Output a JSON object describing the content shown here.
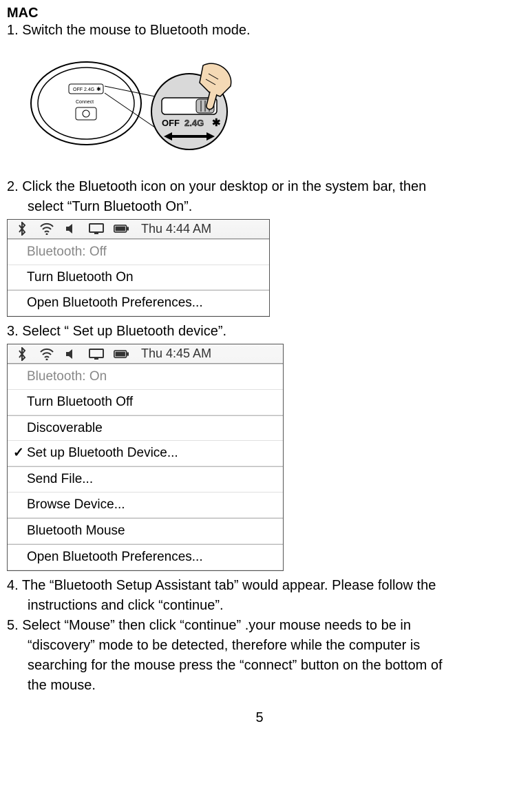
{
  "title": "MAC",
  "steps": {
    "s1": "1. Switch the mouse to Bluetooth mode.",
    "s2a": "2. Click the Bluetooth icon on your desktop or in the system bar, then",
    "s2b": "select “Turn Bluetooth On”.",
    "s3": "3. Select “ Set up Bluetooth device”.",
    "s4a": "4. The “Bluetooth Setup Assistant tab” would appear. Please follow the",
    "s4b": "instructions and click “continue”.",
    "s5a": "5. Select “Mouse” then click “continue” .your mouse needs to be in",
    "s5b": "“discovery” mode to be detected, therefore while the computer is",
    "s5c": "searching for the mouse press the “connect” button on the bottom of",
    "s5d": "the mouse."
  },
  "fig1": {
    "switch_off": "OFF",
    "switch_mid": "2.4G",
    "connect": "Connect"
  },
  "menubar1": {
    "time": "Thu 4:44 AM",
    "items": [
      {
        "label": "Bluetooth: Off",
        "disabled": true
      },
      {
        "label": "Turn Bluetooth On"
      },
      {
        "label": "Open Bluetooth Preferences...",
        "sep": true
      }
    ]
  },
  "menubar2": {
    "time": "Thu 4:45 AM",
    "items": [
      {
        "label": "Bluetooth: On",
        "disabled": true
      },
      {
        "label": "Turn Bluetooth Off"
      },
      {
        "label": "Discoverable",
        "sep": true
      },
      {
        "label": "Set up Bluetooth Device...",
        "check": true
      },
      {
        "label": "Send File...",
        "sep": true
      },
      {
        "label": "Browse Device..."
      },
      {
        "label": "Bluetooth Mouse",
        "sep": true
      },
      {
        "label": "Open Bluetooth Preferences...",
        "sep": true
      }
    ]
  },
  "page": "5"
}
